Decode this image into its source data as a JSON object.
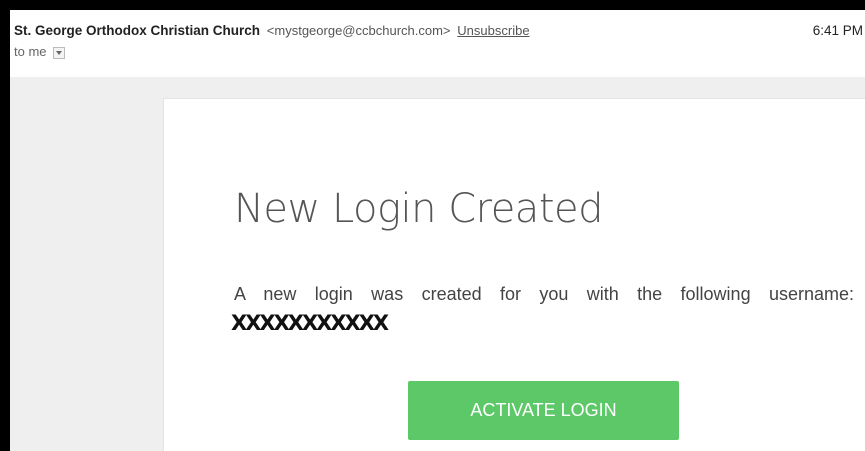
{
  "header": {
    "sender_name": "St. George Orthodox Christian Church",
    "sender_email": "<mystgeorge@ccbchurch.com>",
    "unsubscribe_label": "Unsubscribe",
    "time": "6:41 PM",
    "to_label": "to me"
  },
  "email": {
    "title": "New Login Created",
    "body_text": "A new login was created for you with the following username:",
    "username": "XXXXXXXXXXX",
    "button_label": "ACTIVATE LOGIN",
    "button_color": "#5cc868"
  },
  "icons": {
    "recipient_dropdown": "chevron-down-icon"
  }
}
